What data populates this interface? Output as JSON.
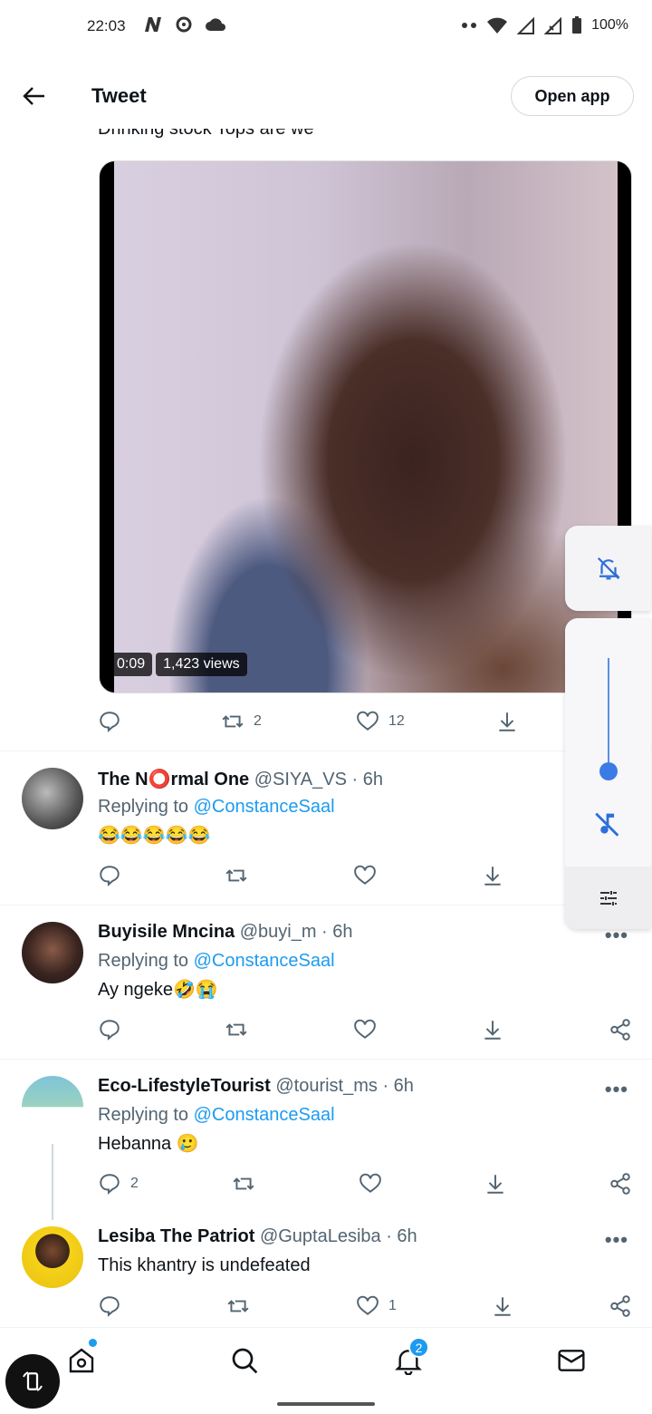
{
  "status_bar": {
    "time": "22:03",
    "battery": "100%",
    "icons": [
      "n-app-icon",
      "sync-icon",
      "cloud-icon",
      "dots-icon",
      "wifi-icon",
      "signal-icon",
      "signal-x-icon",
      "battery-icon"
    ]
  },
  "header": {
    "title": "Tweet",
    "open_app_label": "Open app"
  },
  "tweet": {
    "text_partial": "Drinking stock Tops are we",
    "video": {
      "duration": "0:09",
      "views": "1,423 views"
    },
    "actions": {
      "reply_count": "",
      "retweet_count": "2",
      "like_count": "12"
    }
  },
  "replies": [
    {
      "name": "The N⭕rmal One",
      "handle": "@SIYA_VS · 6h",
      "replying_prefix": "Replying to ",
      "replying_to": "@ConstanceSaal",
      "text": "😂😂😂😂😂",
      "reply_count": "",
      "retweet_count": "",
      "like_count": ""
    },
    {
      "name": "Buyisile Mncina",
      "handle": "@buyi_m · 6h",
      "replying_prefix": "Replying to ",
      "replying_to": "@ConstanceSaal",
      "text": "Ay ngeke🤣😭",
      "reply_count": "",
      "retweet_count": "",
      "like_count": ""
    },
    {
      "name": "Eco-LifestyleTourist",
      "handle": "@tourist_ms · 6h",
      "replying_prefix": "Replying to ",
      "replying_to": "@ConstanceSaal",
      "text": "Hebanna 🥲",
      "reply_count": "2",
      "retweet_count": "",
      "like_count": ""
    },
    {
      "name": "Lesiba The Patriot",
      "handle": "@GuptaLesiba · 6h",
      "text": "This khantry is undefeated",
      "reply_count": "",
      "retweet_count": "",
      "like_count": "1"
    }
  ],
  "more_label": "•••",
  "bottom_nav": {
    "notifications_badge": "2"
  },
  "colors": {
    "accent": "#1d9bf0",
    "text": "#0f1419",
    "secondary": "#536471"
  }
}
